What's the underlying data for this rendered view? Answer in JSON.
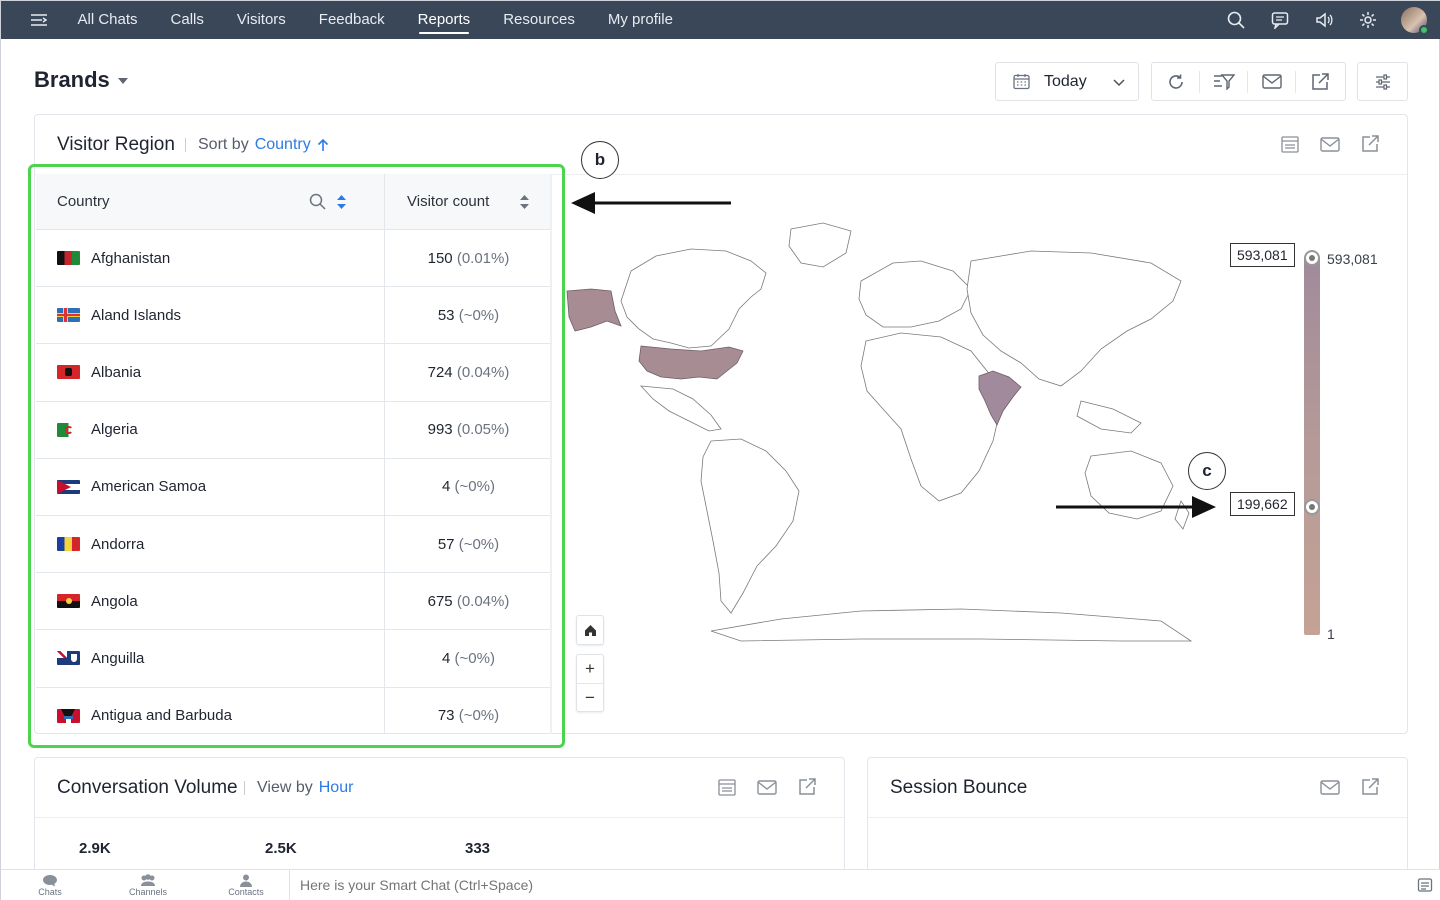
{
  "topnav": {
    "items": [
      {
        "label": "All Chats",
        "active": false
      },
      {
        "label": "Calls",
        "active": false
      },
      {
        "label": "Visitors",
        "active": false
      },
      {
        "label": "Feedback",
        "active": false
      },
      {
        "label": "Reports",
        "active": true
      },
      {
        "label": "Resources",
        "active": false
      },
      {
        "label": "My profile",
        "active": false
      }
    ],
    "icons": [
      "search-icon",
      "chat-bubble-icon",
      "speaker-icon",
      "gear-icon"
    ]
  },
  "header": {
    "title": "Brands",
    "date_filter": "Today"
  },
  "visitor_region": {
    "title": "Visitor Region",
    "sort_label": "Sort by",
    "sort_field": "Country",
    "table": {
      "columns": [
        "Country",
        "Visitor count"
      ],
      "rows": [
        {
          "country": "Afghanistan",
          "count": "150",
          "pct": "(0.01%)"
        },
        {
          "country": "Aland Islands",
          "count": "53",
          "pct": "(~0%)"
        },
        {
          "country": "Albania",
          "count": "724",
          "pct": "(0.04%)"
        },
        {
          "country": "Algeria",
          "count": "993",
          "pct": "(0.05%)"
        },
        {
          "country": "American Samoa",
          "count": "4",
          "pct": "(~0%)"
        },
        {
          "country": "Andorra",
          "count": "57",
          "pct": "(~0%)"
        },
        {
          "country": "Angola",
          "count": "675",
          "pct": "(0.04%)"
        },
        {
          "country": "Anguilla",
          "count": "4",
          "pct": "(~0%)"
        },
        {
          "country": "Antigua and Barbuda",
          "count": "73",
          "pct": "(~0%)"
        }
      ]
    },
    "legend": {
      "max_box": "593,081",
      "max_label": "593,081",
      "mid_box": "199,662",
      "min_label": "1"
    },
    "annotations": {
      "b": "b",
      "c": "c"
    },
    "map_controls": {
      "home": "⌂",
      "zoom_in": "+",
      "zoom_out": "−"
    }
  },
  "conversation_volume": {
    "title": "Conversation Volume",
    "view_label": "View by",
    "view_field": "Hour",
    "metrics": [
      "2.9K",
      "2.5K",
      "333"
    ]
  },
  "session_bounce": {
    "title": "Session Bounce"
  },
  "bottombar": {
    "items": [
      "Chats",
      "Channels",
      "Contacts"
    ],
    "smartchat_placeholder": "Here is your Smart Chat (Ctrl+Space)"
  }
}
